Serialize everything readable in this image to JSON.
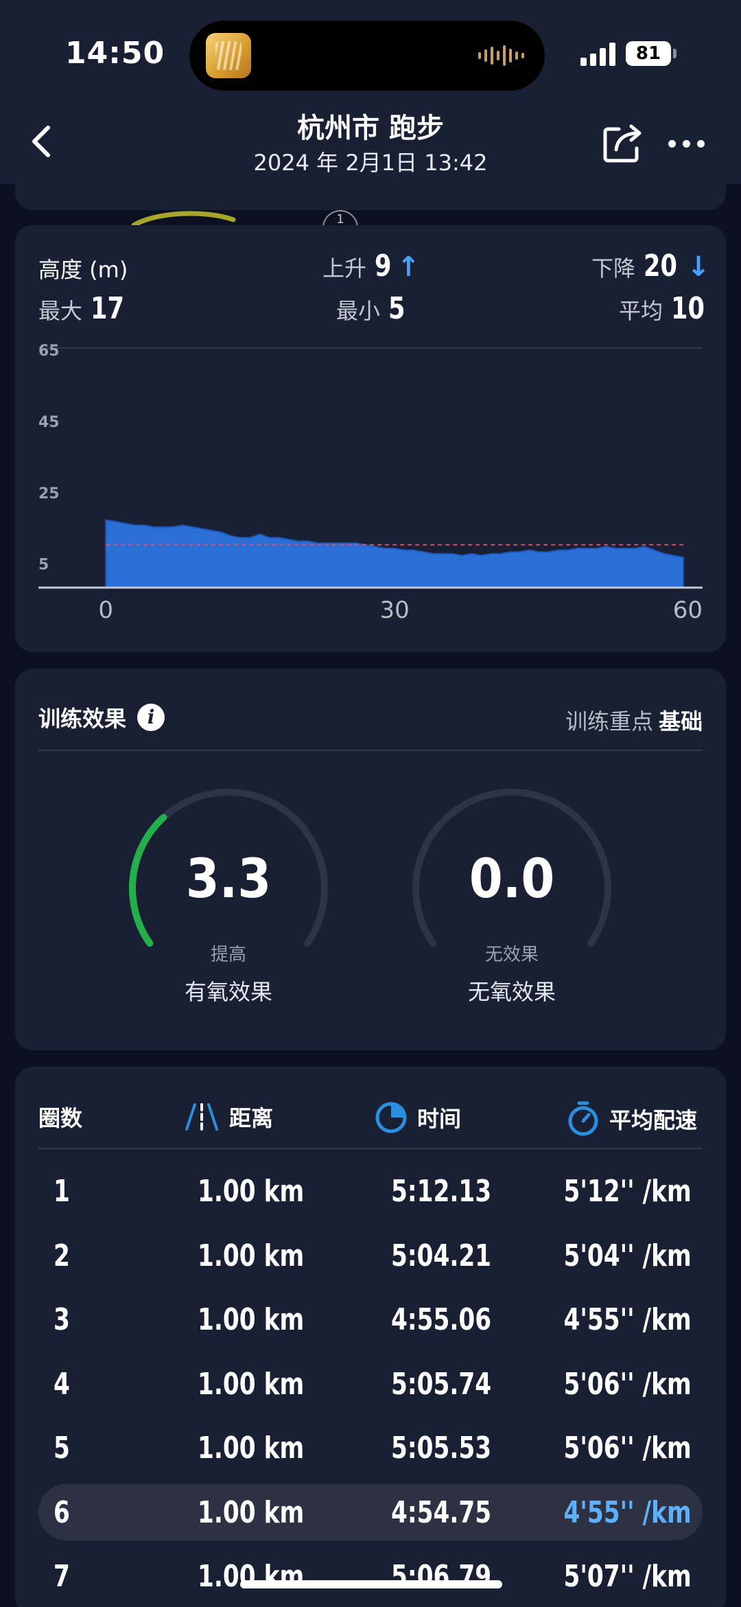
{
  "status_bar": {
    "time": "14:50",
    "battery": "81"
  },
  "header": {
    "title": "杭州市 跑步",
    "subtitle": "2024 年 2月1日 13:42"
  },
  "map": {
    "lap_marker": "1"
  },
  "altitude": {
    "title": "高度 (m)",
    "ascent_label": "上升",
    "ascent_value": "9",
    "descent_label": "下降",
    "descent_value": "20",
    "max_label": "最大",
    "max_value": "17",
    "min_label": "最小",
    "min_value": "5",
    "avg_label": "平均",
    "avg_value": "10"
  },
  "chart_data": {
    "type": "area",
    "title": "高度 (m)",
    "xlabel": "",
    "ylabel": "",
    "y_ticks": [
      "65",
      "45",
      "25",
      "5"
    ],
    "x_ticks": [
      "0",
      "30",
      "60"
    ],
    "ylim": [
      -2,
      65
    ],
    "xlim": [
      -7,
      62
    ],
    "average_line": 10,
    "series": [
      {
        "x": [
          0,
          1,
          2,
          3,
          4,
          5,
          6,
          7,
          8,
          9,
          10,
          11,
          12,
          13,
          14,
          15,
          16,
          17,
          18,
          19,
          20,
          21,
          22,
          23,
          24,
          25,
          26,
          27,
          28,
          29,
          30,
          31,
          32,
          33,
          34,
          35,
          36,
          37,
          38,
          39,
          40,
          41,
          42,
          43,
          44,
          45,
          46,
          47,
          48,
          49,
          50,
          51,
          52,
          53,
          54,
          55,
          56,
          57,
          58,
          59,
          60
        ],
        "values": [
          17,
          16.5,
          16,
          15.5,
          15.5,
          15,
          15,
          15,
          15.5,
          15,
          14.5,
          14,
          13.5,
          12.5,
          12,
          12,
          13,
          12,
          12,
          11.5,
          11,
          11,
          10.5,
          10.5,
          10.5,
          10.5,
          10.5,
          10,
          9.5,
          9,
          9,
          8.5,
          8.5,
          8,
          7.5,
          7.5,
          7.5,
          7,
          7.5,
          7,
          7.5,
          7.5,
          8,
          8,
          8.5,
          8,
          8,
          8.5,
          8.5,
          9,
          9,
          9,
          9.5,
          9,
          9,
          9,
          9.5,
          8.5,
          7.5,
          7,
          6.5
        ]
      }
    ]
  },
  "training": {
    "title": "训练效果",
    "focus_label": "训练重点",
    "focus_value": "基础",
    "aerobic": {
      "value": "3.3",
      "status": "提高",
      "label": "有氧效果",
      "fraction": 0.33
    },
    "anaerobic": {
      "value": "0.0",
      "status": "无效果",
      "label": "无氧效果",
      "fraction": 0.0
    },
    "colors": {
      "aerobic_arc": "#23b04a",
      "track": "#2e3447"
    }
  },
  "laps": {
    "headers": {
      "lap": "圈数",
      "distance": "距离",
      "time": "时间",
      "pace": "平均配速"
    },
    "rows": [
      {
        "lap": "1",
        "distance": "1.00 km",
        "time": "5:12.13",
        "pace": "5'12'' /km"
      },
      {
        "lap": "2",
        "distance": "1.00 km",
        "time": "5:04.21",
        "pace": "5'04'' /km"
      },
      {
        "lap": "3",
        "distance": "1.00 km",
        "time": "4:55.06",
        "pace": "4'55'' /km"
      },
      {
        "lap": "4",
        "distance": "1.00 km",
        "time": "5:05.74",
        "pace": "5'06'' /km"
      },
      {
        "lap": "5",
        "distance": "1.00 km",
        "time": "5:05.53",
        "pace": "5'06'' /km"
      },
      {
        "lap": "6",
        "distance": "1.00 km",
        "time": "4:54.75",
        "pace": "4'55'' /km"
      },
      {
        "lap": "7",
        "distance": "1.00 km",
        "time": "5:06.79",
        "pace": "5'07'' /km"
      }
    ],
    "highlighted_lap": "6",
    "colors": {
      "icon": "#2b8fe0",
      "highlight_text": "#5eb0ff"
    }
  }
}
